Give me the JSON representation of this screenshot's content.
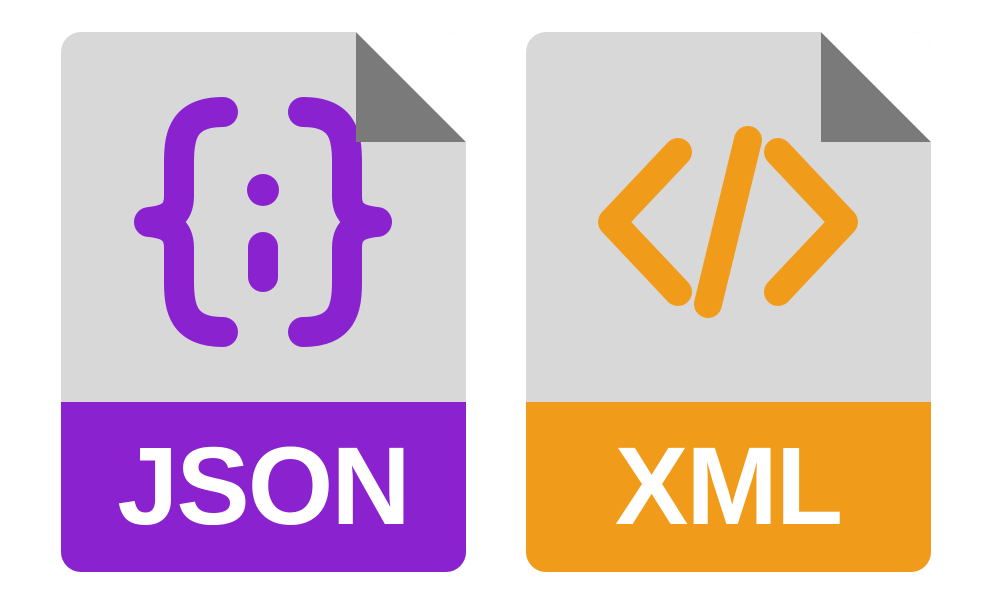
{
  "files": {
    "json": {
      "label": "JSON",
      "accent_color": "#8b22cf",
      "icon": "curly-braces-icon"
    },
    "xml": {
      "label": "XML",
      "accent_color": "#f09c1a",
      "icon": "angle-brackets-icon"
    }
  },
  "colors": {
    "paper": "#d8d8d8",
    "fold": "#7a7a7a",
    "json_accent": "#8b22cf",
    "xml_accent": "#f09c1a",
    "label_text": "#ffffff"
  }
}
